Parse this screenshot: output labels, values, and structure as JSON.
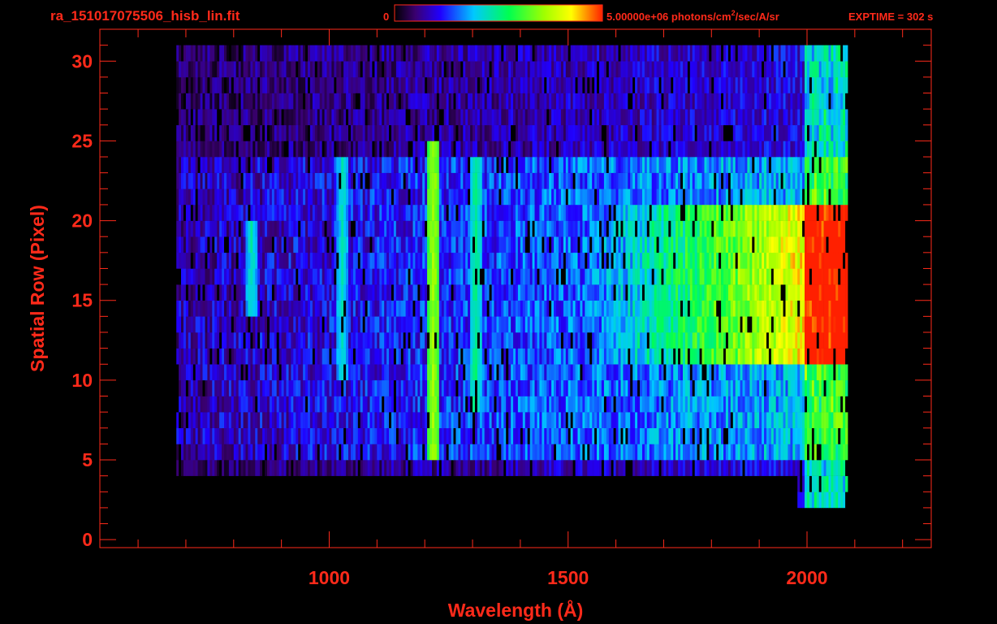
{
  "header": {
    "filename": "ra_151017075506_hisb_lin.fit",
    "colorbar_min_label": "0",
    "colorbar_max_label": "5.00000e+06 photons/cm",
    "colorbar_max_sup": "2",
    "colorbar_max_suffix": "/sec/A/sr",
    "exptime": "EXPTIME = 302 s"
  },
  "colors": {
    "text": "#ff2a1a",
    "axis": "#ff2a1a",
    "background": "#000000"
  },
  "chart_data": {
    "type": "heatmap",
    "title": "",
    "xlabel": "Wavelength (Å)",
    "ylabel": "Spatial Row (Pixel)",
    "xlim": [
      520,
      2260
    ],
    "ylim": [
      -0.5,
      32
    ],
    "x_ticks": [
      1000,
      1500,
      2000
    ],
    "y_ticks": [
      0,
      5,
      10,
      15,
      20,
      25,
      30
    ],
    "color_scale": {
      "min": 0,
      "max": 5000000,
      "units": "photons/cm^2/sec/A/sr",
      "colormap": "rainbow"
    },
    "spectral_range_angstrom": [
      690,
      2060
    ],
    "bright_rows": [
      5,
      23
    ],
    "emission_lines": [
      {
        "wavelength": 835,
        "rows": [
          14,
          19
        ],
        "peak_fraction": 0.45
      },
      {
        "wavelength": 1025,
        "rows": [
          10,
          23
        ],
        "peak_fraction": 0.45
      },
      {
        "wavelength": 1216,
        "rows": [
          5,
          24
        ],
        "peak_fraction": 0.72
      },
      {
        "wavelength": 1304,
        "rows": [
          8,
          23
        ],
        "peak_fraction": 0.5
      }
    ],
    "continuum": {
      "rows": [
        11,
        20
      ],
      "peak_wavelength": 1960,
      "peak_fraction": 0.82
    }
  }
}
